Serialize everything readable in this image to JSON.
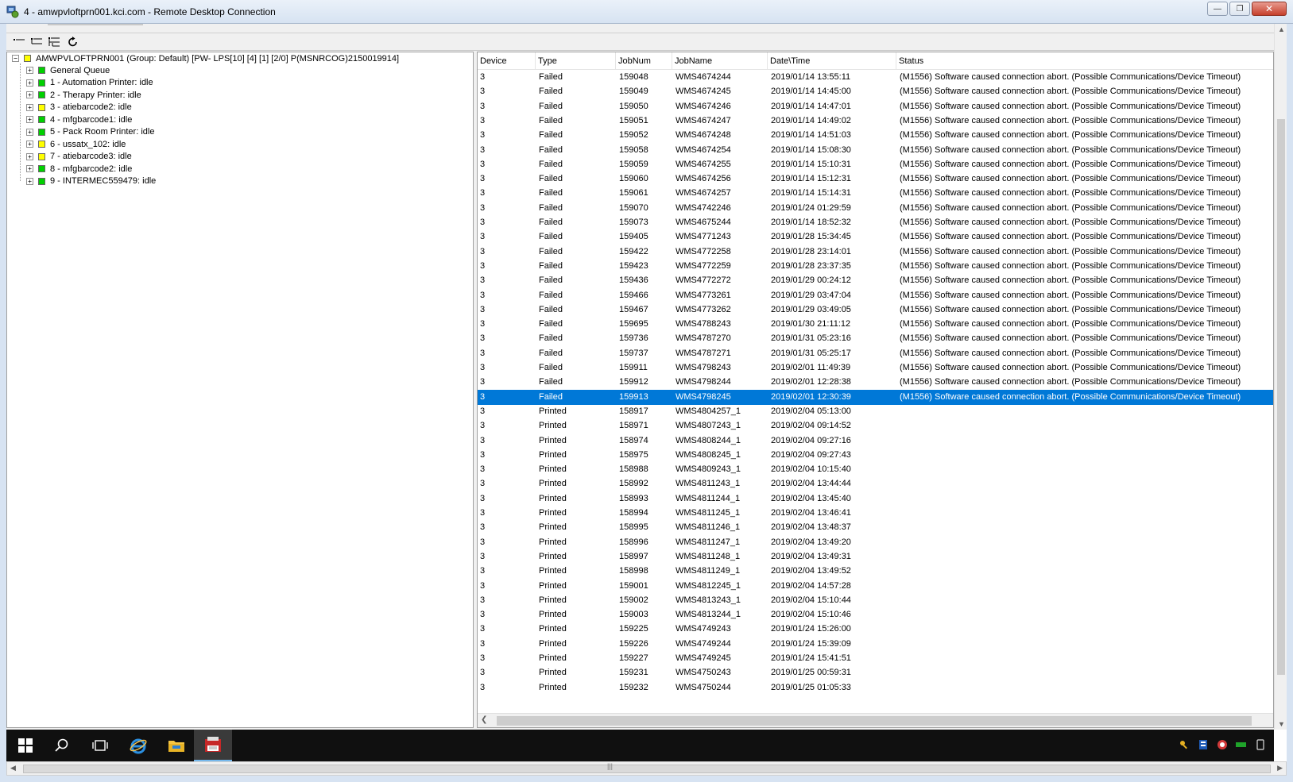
{
  "window": {
    "title": "4 - amwpvloftprn001.kci.com - Remote Desktop Connection"
  },
  "toolbar": {
    "buttons": [
      "collapse-tree-icon",
      "expand-level-icon",
      "expand-all-icon",
      "refresh-icon"
    ]
  },
  "tree": {
    "root": {
      "label": "AMWPVLOFTPRN001 (Group: Default) [PW- LPS[10] [4] [1] [2/0]  P(MSNRCOG)2150019914]",
      "status_color": "#ffff00",
      "expander": "−"
    },
    "children": [
      {
        "label": "General Queue",
        "status_color": "#00d000",
        "expander": "+"
      },
      {
        "label": "1 - Automation Printer: idle",
        "status_color": "#00d000",
        "expander": "+"
      },
      {
        "label": "2 - Therapy Printer: idle",
        "status_color": "#00d000",
        "expander": "+"
      },
      {
        "label": "3 - atiebarcode2: idle",
        "status_color": "#ffff00",
        "expander": "+"
      },
      {
        "label": "4 - mfgbarcode1: idle",
        "status_color": "#00d000",
        "expander": "+"
      },
      {
        "label": "5 - Pack Room Printer: idle",
        "status_color": "#00d000",
        "expander": "+"
      },
      {
        "label": "6 - ussatx_102: idle",
        "status_color": "#ffff00",
        "expander": "+"
      },
      {
        "label": "7 - atiebarcode3: idle",
        "status_color": "#ffff00",
        "expander": "+"
      },
      {
        "label": "8 - mfgbarcode2: idle",
        "status_color": "#00d000",
        "expander": "+"
      },
      {
        "label": "9 - INTERMEC559479: idle",
        "status_color": "#00d000",
        "expander": "+"
      }
    ]
  },
  "jobs": {
    "columns": [
      "Device",
      "Type",
      "JobNum",
      "JobName",
      "Date\\Time",
      "Status"
    ],
    "selected_color": "#0078d7",
    "rows": [
      [
        "3",
        "Failed",
        "159048",
        "WMS4674244",
        "2019/01/14  13:55:11",
        "(M1556) Software caused connection abort. (Possible Communications/Device Timeout)"
      ],
      [
        "3",
        "Failed",
        "159049",
        "WMS4674245",
        "2019/01/14  14:45:00",
        "(M1556) Software caused connection abort. (Possible Communications/Device Timeout)"
      ],
      [
        "3",
        "Failed",
        "159050",
        "WMS4674246",
        "2019/01/14  14:47:01",
        "(M1556) Software caused connection abort. (Possible Communications/Device Timeout)"
      ],
      [
        "3",
        "Failed",
        "159051",
        "WMS4674247",
        "2019/01/14  14:49:02",
        "(M1556) Software caused connection abort. (Possible Communications/Device Timeout)"
      ],
      [
        "3",
        "Failed",
        "159052",
        "WMS4674248",
        "2019/01/14  14:51:03",
        "(M1556) Software caused connection abort. (Possible Communications/Device Timeout)"
      ],
      [
        "3",
        "Failed",
        "159058",
        "WMS4674254",
        "2019/01/14  15:08:30",
        "(M1556) Software caused connection abort. (Possible Communications/Device Timeout)"
      ],
      [
        "3",
        "Failed",
        "159059",
        "WMS4674255",
        "2019/01/14  15:10:31",
        "(M1556) Software caused connection abort. (Possible Communications/Device Timeout)"
      ],
      [
        "3",
        "Failed",
        "159060",
        "WMS4674256",
        "2019/01/14  15:12:31",
        "(M1556) Software caused connection abort. (Possible Communications/Device Timeout)"
      ],
      [
        "3",
        "Failed",
        "159061",
        "WMS4674257",
        "2019/01/14  15:14:31",
        "(M1556) Software caused connection abort. (Possible Communications/Device Timeout)"
      ],
      [
        "3",
        "Failed",
        "159070",
        "WMS4742246",
        "2019/01/24  01:29:59",
        "(M1556) Software caused connection abort. (Possible Communications/Device Timeout)"
      ],
      [
        "3",
        "Failed",
        "159073",
        "WMS4675244",
        "2019/01/14  18:52:32",
        "(M1556) Software caused connection abort. (Possible Communications/Device Timeout)"
      ],
      [
        "3",
        "Failed",
        "159405",
        "WMS4771243",
        "2019/01/28  15:34:45",
        "(M1556) Software caused connection abort. (Possible Communications/Device Timeout)"
      ],
      [
        "3",
        "Failed",
        "159422",
        "WMS4772258",
        "2019/01/28  23:14:01",
        "(M1556) Software caused connection abort. (Possible Communications/Device Timeout)"
      ],
      [
        "3",
        "Failed",
        "159423",
        "WMS4772259",
        "2019/01/28  23:37:35",
        "(M1556) Software caused connection abort. (Possible Communications/Device Timeout)"
      ],
      [
        "3",
        "Failed",
        "159436",
        "WMS4772272",
        "2019/01/29  00:24:12",
        "(M1556) Software caused connection abort. (Possible Communications/Device Timeout)"
      ],
      [
        "3",
        "Failed",
        "159466",
        "WMS4773261",
        "2019/01/29  03:47:04",
        "(M1556) Software caused connection abort. (Possible Communications/Device Timeout)"
      ],
      [
        "3",
        "Failed",
        "159467",
        "WMS4773262",
        "2019/01/29  03:49:05",
        "(M1556) Software caused connection abort. (Possible Communications/Device Timeout)"
      ],
      [
        "3",
        "Failed",
        "159695",
        "WMS4788243",
        "2019/01/30  21:11:12",
        "(M1556) Software caused connection abort. (Possible Communications/Device Timeout)"
      ],
      [
        "3",
        "Failed",
        "159736",
        "WMS4787270",
        "2019/01/31  05:23:16",
        "(M1556) Software caused connection abort. (Possible Communications/Device Timeout)"
      ],
      [
        "3",
        "Failed",
        "159737",
        "WMS4787271",
        "2019/01/31  05:25:17",
        "(M1556) Software caused connection abort. (Possible Communications/Device Timeout)"
      ],
      [
        "3",
        "Failed",
        "159911",
        "WMS4798243",
        "2019/02/01  11:49:39",
        "(M1556) Software caused connection abort. (Possible Communications/Device Timeout)"
      ],
      [
        "3",
        "Failed",
        "159912",
        "WMS4798244",
        "2019/02/01  12:28:38",
        "(M1556) Software caused connection abort. (Possible Communications/Device Timeout)"
      ],
      [
        "3",
        "Failed",
        "159913",
        "WMS4798245",
        "2019/02/01  12:30:39",
        "(M1556) Software caused connection abort. (Possible Communications/Device Timeout)"
      ],
      [
        "3",
        "Printed",
        "158917",
        "WMS4804257_1",
        "2019/02/04  05:13:00",
        ""
      ],
      [
        "3",
        "Printed",
        "158971",
        "WMS4807243_1",
        "2019/02/04  09:14:52",
        ""
      ],
      [
        "3",
        "Printed",
        "158974",
        "WMS4808244_1",
        "2019/02/04  09:27:16",
        ""
      ],
      [
        "3",
        "Printed",
        "158975",
        "WMS4808245_1",
        "2019/02/04  09:27:43",
        ""
      ],
      [
        "3",
        "Printed",
        "158988",
        "WMS4809243_1",
        "2019/02/04  10:15:40",
        ""
      ],
      [
        "3",
        "Printed",
        "158992",
        "WMS4811243_1",
        "2019/02/04  13:44:44",
        ""
      ],
      [
        "3",
        "Printed",
        "158993",
        "WMS4811244_1",
        "2019/02/04  13:45:40",
        ""
      ],
      [
        "3",
        "Printed",
        "158994",
        "WMS4811245_1",
        "2019/02/04  13:46:41",
        ""
      ],
      [
        "3",
        "Printed",
        "158995",
        "WMS4811246_1",
        "2019/02/04  13:48:37",
        ""
      ],
      [
        "3",
        "Printed",
        "158996",
        "WMS4811247_1",
        "2019/02/04  13:49:20",
        ""
      ],
      [
        "3",
        "Printed",
        "158997",
        "WMS4811248_1",
        "2019/02/04  13:49:31",
        ""
      ],
      [
        "3",
        "Printed",
        "158998",
        "WMS4811249_1",
        "2019/02/04  13:49:52",
        ""
      ],
      [
        "3",
        "Printed",
        "159001",
        "WMS4812245_1",
        "2019/02/04  14:57:28",
        ""
      ],
      [
        "3",
        "Printed",
        "159002",
        "WMS4813243_1",
        "2019/02/04  15:10:44",
        ""
      ],
      [
        "3",
        "Printed",
        "159003",
        "WMS4813244_1",
        "2019/02/04  15:10:46",
        ""
      ],
      [
        "3",
        "Printed",
        "159225",
        "WMS4749243",
        "2019/01/24  15:26:00",
        ""
      ],
      [
        "3",
        "Printed",
        "159226",
        "WMS4749244",
        "2019/01/24  15:39:09",
        ""
      ],
      [
        "3",
        "Printed",
        "159227",
        "WMS4749245",
        "2019/01/24  15:41:51",
        ""
      ],
      [
        "3",
        "Printed",
        "159231",
        "WMS4750243",
        "2019/01/25  00:59:31",
        ""
      ],
      [
        "3",
        "Printed",
        "159232",
        "WMS4750244",
        "2019/01/25  01:05:33",
        ""
      ]
    ],
    "selected_index": 22
  },
  "taskbar": {
    "items": [
      "windows-start-icon",
      "search-icon",
      "task-view-icon",
      "internet-explorer-icon",
      "file-explorer-icon",
      "print-app-icon"
    ],
    "active_item": "print-app-icon"
  }
}
